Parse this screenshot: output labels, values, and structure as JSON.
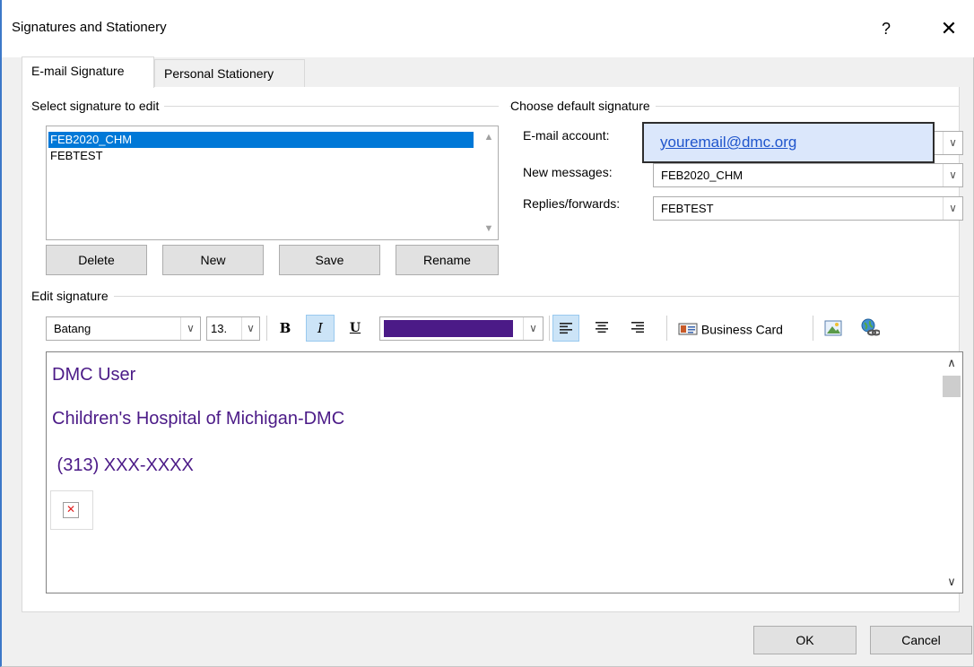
{
  "window": {
    "title": "Signatures and Stationery",
    "help_glyph": "?",
    "close_glyph": "✕"
  },
  "tabs": [
    {
      "label": "E-mail Signature",
      "active": true
    },
    {
      "label": "Personal Stationery",
      "active": false
    }
  ],
  "select_signature": {
    "group_label": "Select signature to edit",
    "items": [
      {
        "label": "FEB2020_CHM",
        "selected": true
      },
      {
        "label": "FEBTEST",
        "selected": false
      }
    ],
    "buttons": {
      "delete": "Delete",
      "new": "New",
      "save": "Save",
      "rename": "Rename"
    }
  },
  "default_signature": {
    "group_label": "Choose default signature",
    "email_account_label": "E-mail account:",
    "email_account_value": "youremail@dmc.org",
    "new_messages_label": "New messages:",
    "new_messages_value": "FEB2020_CHM",
    "replies_label": "Replies/forwards:",
    "replies_value": "FEBTEST"
  },
  "edit_signature": {
    "group_label": "Edit signature",
    "font_name": "Batang",
    "font_size": "13.",
    "font_color": "#4b1a87",
    "bold_label": "B",
    "italic_label": "I",
    "underline_label": "U",
    "business_card_label": "Business Card",
    "body_lines": [
      "DMC User",
      "Children's Hospital of Michigan-DMC",
      " (313) XXX-XXXX"
    ]
  },
  "footer": {
    "ok": "OK",
    "cancel": "Cancel"
  },
  "icons": {
    "align_left": "align-left-icon",
    "align_center": "align-center-icon",
    "align_right": "align-right-icon",
    "business_card": "business-card-icon",
    "insert_picture": "insert-picture-icon",
    "hyperlink": "hyperlink-icon",
    "broken_image": "broken-image-icon"
  }
}
